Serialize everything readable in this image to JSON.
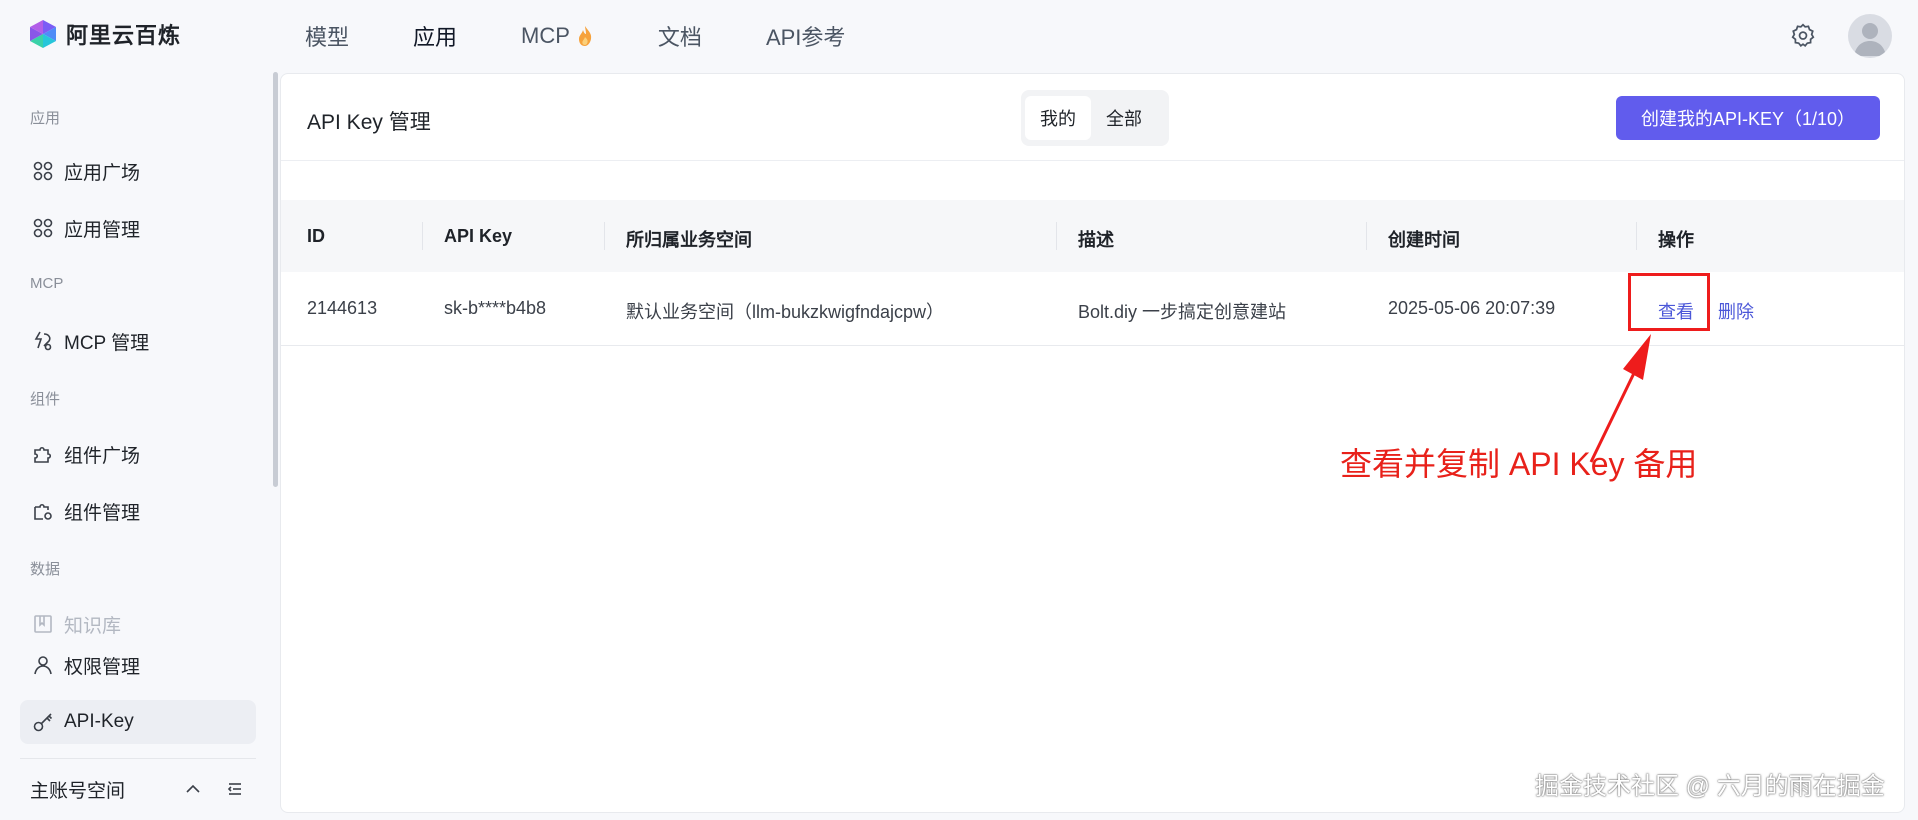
{
  "app": {
    "name": "阿里云百炼"
  },
  "nav": {
    "items": [
      {
        "label": "模型"
      },
      {
        "label": "应用"
      },
      {
        "label": "MCP"
      },
      {
        "label": "文档"
      },
      {
        "label": "API参考"
      }
    ],
    "active": "应用"
  },
  "sidebar": {
    "sections": {
      "app": "应用",
      "mcp": "MCP",
      "component": "组件",
      "data": "数据"
    },
    "items": {
      "app_plaza": "应用广场",
      "app_manage": "应用管理",
      "mcp_manage": "MCP 管理",
      "comp_plaza": "组件广场",
      "comp_manage": "组件管理",
      "knowledge": "知识库",
      "permission": "权限管理",
      "api_key": "API-Key"
    },
    "account": "主账号空间"
  },
  "main": {
    "title": "API Key 管理",
    "tabs": [
      {
        "label": "我的"
      },
      {
        "label": "全部"
      }
    ],
    "create_button": "创建我的API-KEY（1/10）",
    "table": {
      "headers": {
        "id": "ID",
        "api_key": "API Key",
        "workspace": "所归属业务空间",
        "desc": "描述",
        "created": "创建时间",
        "ops": "操作"
      },
      "row": {
        "id": "2144613",
        "api_key": "sk-b****b4b8",
        "workspace": "默认业务空间（llm-bukzkwigfndajcpw）",
        "desc": "Bolt.diy 一步搞定创意建站",
        "created": "2025-05-06 20:07:39",
        "view": "查看",
        "delete": "删除"
      }
    }
  },
  "annotation": {
    "text": "查看并复制 API Key 备用"
  },
  "watermark": "掘金技术社区 @ 六月的雨在掘金",
  "colors": {
    "primary": "#615ced",
    "link": "#4b57d8",
    "annotation": "#e8211a"
  }
}
